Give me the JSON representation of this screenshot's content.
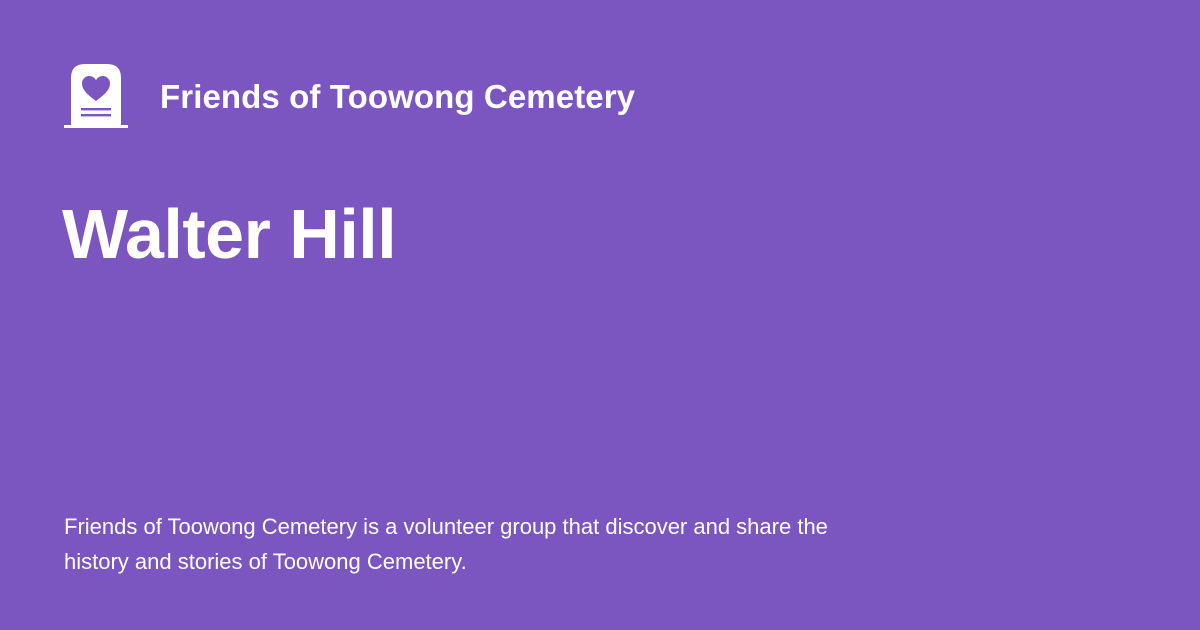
{
  "brand": {
    "icon": "heart-headstone-icon",
    "name": "Friends of Toowong Cemetery"
  },
  "page": {
    "title": "Walter Hill",
    "description": "Friends of Toowong Cemetery is a volunteer group that discover and share the history and stories of Toowong Cemetery."
  },
  "colors": {
    "background": "#7b55c0",
    "foreground": "#ffffff"
  }
}
